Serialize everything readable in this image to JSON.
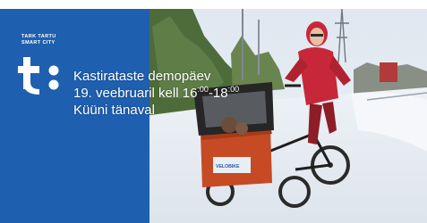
{
  "brand": {
    "line1": "TARK TARTU",
    "line2": "SMART CITY"
  },
  "headline": {
    "title": "Kastirataste demopäev",
    "date_prefix": "19. veebruaril kell 16",
    "time_start_sup": ":00",
    "time_dash": "-18",
    "time_end_sup": ":00",
    "location": "Küüni tänaval"
  },
  "bike_sign": "VELOBIKE",
  "colors": {
    "panel": "#1f5fb0",
    "cargo_box": "#c64a24",
    "jacket": "#c8273a"
  }
}
